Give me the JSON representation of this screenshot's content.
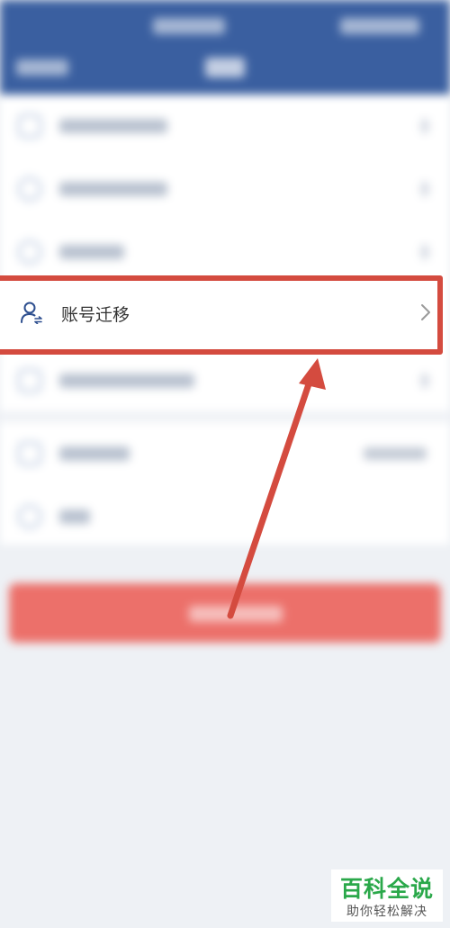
{
  "focused_item": {
    "label": "账号迁移",
    "icon": "user-transfer-icon",
    "trailing_icon": "chevron-right-icon"
  },
  "watermark": {
    "title": "百科全说",
    "subtitle": "助你轻松解决"
  },
  "colors": {
    "header": "#3a5fa0",
    "highlight_border": "#d44b3f",
    "logout_button": "#ec706a",
    "watermark_green": "#2aa84a"
  }
}
